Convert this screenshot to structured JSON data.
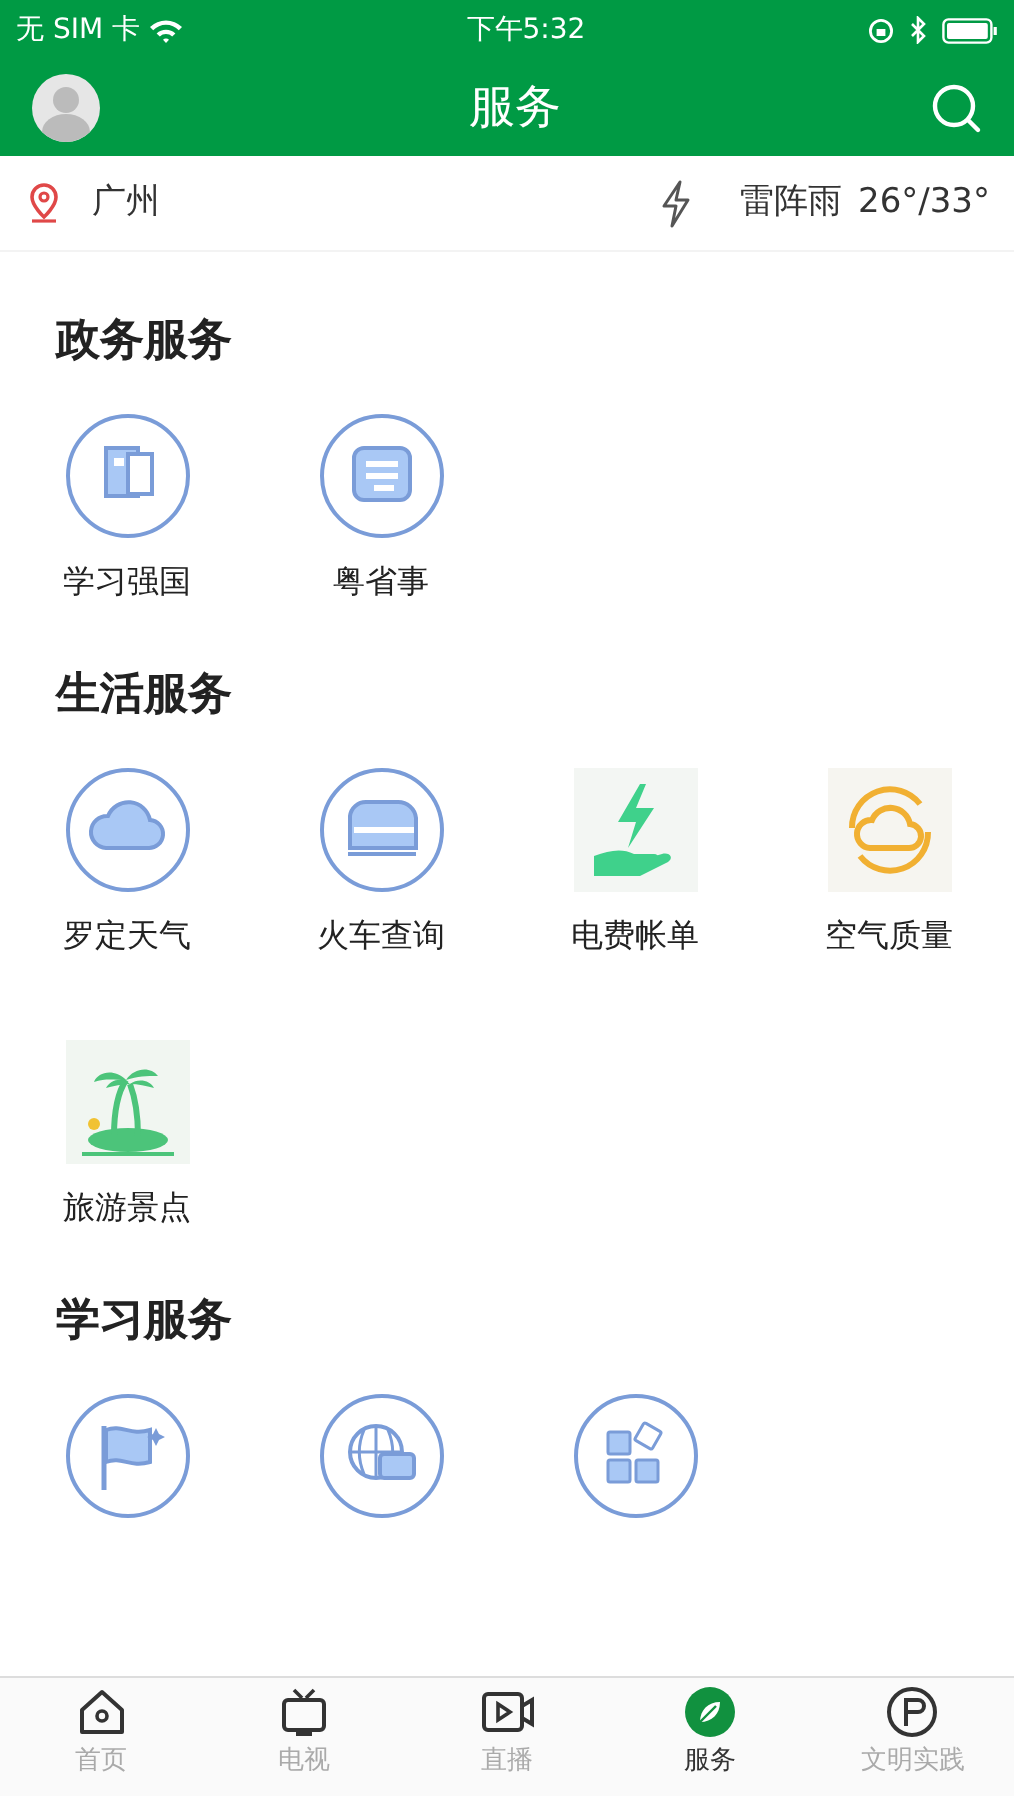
{
  "status_bar": {
    "carrier": "无 SIM 卡",
    "time": "下午5:32"
  },
  "header": {
    "title": "服务"
  },
  "weather_bar": {
    "city": "广州",
    "condition": "雷阵雨",
    "temperature": "26°/33°"
  },
  "sections": [
    {
      "title": "政务服务",
      "items": [
        {
          "label": "学习强国",
          "kind": "circle"
        },
        {
          "label": "粤省事",
          "kind": "circle"
        }
      ]
    },
    {
      "title": "生活服务",
      "items": [
        {
          "label": "罗定天气",
          "kind": "circle"
        },
        {
          "label": "火车查询",
          "kind": "circle"
        },
        {
          "label": "电费帐单",
          "kind": "tile"
        },
        {
          "label": "空气质量",
          "kind": "tile"
        },
        {
          "label": "旅游景点",
          "kind": "tile"
        }
      ]
    },
    {
      "title": "学习服务",
      "items": [
        {
          "kind": "circle"
        },
        {
          "kind": "circle"
        },
        {
          "kind": "circle"
        }
      ]
    }
  ],
  "tab_bar": [
    {
      "label": "首页",
      "selected": false
    },
    {
      "label": "电视",
      "selected": false
    },
    {
      "label": "直播",
      "selected": false
    },
    {
      "label": "服务",
      "selected": true
    },
    {
      "label": "文明实践",
      "selected": false
    }
  ]
}
